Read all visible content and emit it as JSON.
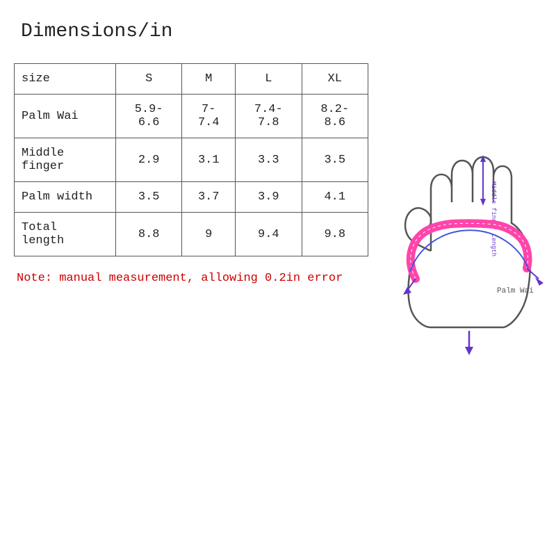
{
  "title": "Dimensions/in",
  "table": {
    "headers": [
      "size",
      "S",
      "M",
      "L",
      "XL"
    ],
    "rows": [
      [
        "Palm Wai",
        "5.9-6.6",
        "7-7.4",
        "7.4-7.8",
        "8.2-8.6"
      ],
      [
        "Middle finger",
        "2.9",
        "3.1",
        "3.3",
        "3.5"
      ],
      [
        "Palm width",
        "3.5",
        "3.7",
        "3.9",
        "4.1"
      ],
      [
        "Total length",
        "8.8",
        "9",
        "9.4",
        "9.8"
      ]
    ]
  },
  "note": "Note: manual measurement, allowing 0.2in error",
  "diagram": {
    "palm_wai_label": "Palm Wai",
    "middle_finger_label": "Middle finger Length"
  }
}
